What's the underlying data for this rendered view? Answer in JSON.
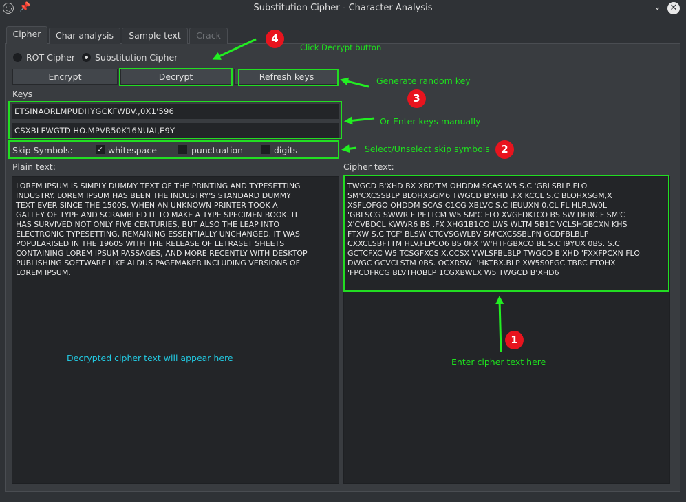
{
  "window": {
    "title": "Substitution Cipher - Character Analysis"
  },
  "tabs": [
    {
      "label": "Cipher",
      "active": true,
      "disabled": false
    },
    {
      "label": "Char analysis",
      "active": false,
      "disabled": false
    },
    {
      "label": "Sample text",
      "active": false,
      "disabled": false
    },
    {
      "label": "Crack",
      "active": false,
      "disabled": true
    }
  ],
  "mode": {
    "rot_label": "ROT Cipher",
    "rot_selected": false,
    "substitution_label": "Substitution Cipher",
    "substitution_selected": true
  },
  "buttons": {
    "encrypt": "Encrypt",
    "decrypt": "Decrypt",
    "refresh_keys": "Refresh keys"
  },
  "keys": {
    "label": "Keys",
    "key1": "ETSINAORLMPUDHYGCKFWBV.,0X1'596",
    "key2": "CSXBLFWGTD'HO.MPVR50K16NUAI,E9Y"
  },
  "skip_symbols": {
    "label": "Skip Symbols:",
    "whitespace": {
      "label": "whitespace",
      "checked": true
    },
    "punctuation": {
      "label": "punctuation",
      "checked": false
    },
    "digits": {
      "label": "digits",
      "checked": false
    }
  },
  "plain": {
    "label": "Plain text:",
    "text": "LOREM IPSUM IS SIMPLY DUMMY TEXT OF THE PRINTING AND TYPESETTING\nINDUSTRY. LOREM IPSUM HAS BEEN THE INDUSTRY'S STANDARD DUMMY\nTEXT EVER SINCE THE 1500S, WHEN AN UNKNOWN PRINTER TOOK A\nGALLEY OF TYPE AND SCRAMBLED IT TO MAKE A TYPE SPECIMEN BOOK. IT\nHAS SURVIVED NOT ONLY FIVE CENTURIES, BUT ALSO THE LEAP INTO\nELECTRONIC TYPESETTING, REMAINING ESSENTIALLY UNCHANGED. IT WAS\nPOPULARISED IN THE 1960S WITH THE RELEASE OF LETRASET SHEETS\nCONTAINING LOREM IPSUM PASSAGES, AND MORE RECENTLY WITH DESKTOP\nPUBLISHING SOFTWARE LIKE ALDUS PAGEMAKER INCLUDING VERSIONS OF\nLOREM IPSUM."
  },
  "cipher": {
    "label": "Cipher text:",
    "text": "TWGCD B'XHD BX XBD'TM OHDDM SCAS W5 S.C 'GBLSBLP FLO\nSM'CXCSSBLP BLOHXSGM6 TWGCD B'XHD .FX KCCL S.C BLOHXSGM,X\nXSFLOFGO OHDDM SCAS C1CG XBLVC S.C IEUUXN 0.CL FL HLRLW0L\n'GBLSCG SWWR F PFTTCM W5 SM'C FLO XVGFDKTCO BS SW DFRC F SM'C\nX'CVBDCL KWWR6 BS .FX XHG1B1CO LWS WLTM 5B1C VCLSHGBCXN KHS\nFTXW S.C TCF' BLSW CTCVSGWLBV SM'CXCSSBLPN GCDFBLBLP\nCXXCLSBFTTM HLV.FLPCO6 BS 0FX 'W'HTFGBXCO BL S.C I9YUX 0BS. S.C\nGCTCFXC W5 TCSGFXCS X.CCSX VWLSFBLBLP TWGCD B'XHD 'FXXFPCXN FLO\nDWGC GCVCLSTM 0BS. OCXRSW' 'HKTBX.BLP XW5S0FGC TBRC FTOHX\n'FPCDFRCG BLVTHOBLP 1CGXBWLX W5 TWGCD B'XHD6"
  },
  "annotations": {
    "step1": {
      "number": "1",
      "text": "Enter cipher text here"
    },
    "step2": {
      "number": "2",
      "text": "Select/Unselect skip symbols"
    },
    "step3": {
      "number": "3",
      "text": "Generate random key"
    },
    "step3b": {
      "text": "Or Enter keys manually"
    },
    "step4": {
      "number": "4",
      "text": "Click Decrypt button"
    },
    "plain_note": "Decrypted cipher text will appear here",
    "color": "#1ee01e",
    "note_color": "#22c8e0",
    "badge_color": "#e8141e"
  }
}
